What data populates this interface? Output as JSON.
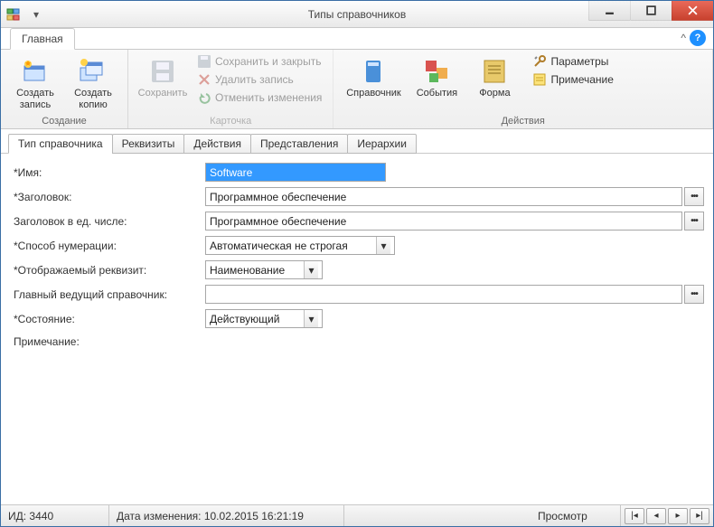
{
  "window": {
    "title": "Типы справочников"
  },
  "ribbon": {
    "tab_main": "Главная",
    "groups": {
      "create": {
        "caption": "Создание",
        "new_record": "Создать\nзапись",
        "new_copy": "Создать\nкопию"
      },
      "card": {
        "caption": "Карточка",
        "save": "Сохранить",
        "save_close": "Сохранить и закрыть",
        "delete": "Удалить запись",
        "undo": "Отменить изменения"
      },
      "actions": {
        "caption": "Действия",
        "directory": "Справочник",
        "events": "События",
        "form": "Форма",
        "parameters": "Параметры",
        "note": "Примечание"
      }
    }
  },
  "subtabs": {
    "type": "Тип справочника",
    "props": "Реквизиты",
    "actions": "Действия",
    "views": "Представления",
    "hier": "Иерархии"
  },
  "form": {
    "name_label": "*Имя:",
    "name_value": "Software",
    "title_label": "*Заголовок:",
    "title_value": "Программное обеспечение",
    "title_sing_label": "Заголовок в ед. числе:",
    "title_sing_value": "Программное обеспечение",
    "numbering_label": "*Способ нумерации:",
    "numbering_value": "Автоматическая не строгая",
    "displayed_label": "*Отображаемый реквизит:",
    "displayed_value": "Наименование",
    "leading_label": "Главный ведущий справочник:",
    "leading_value": "",
    "state_label": "*Состояние:",
    "state_value": "Действующий",
    "remark_label": "Примечание:"
  },
  "status": {
    "id_label": "ИД: 3440",
    "modified_label": "Дата изменения: 10.02.2015 16:21:19",
    "mode": "Просмотр"
  }
}
